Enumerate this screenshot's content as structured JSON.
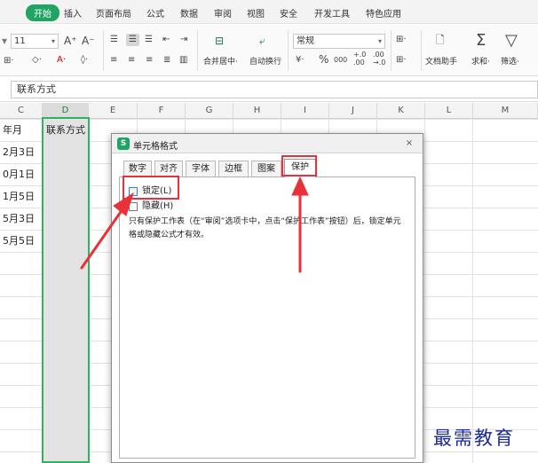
{
  "menu": {
    "items": [
      "开始",
      "插入",
      "页面布局",
      "公式",
      "数据",
      "审阅",
      "视图",
      "安全",
      "开发工具",
      "特色应用"
    ],
    "active_index": 0
  },
  "toolbar": {
    "font_size": "11",
    "font_size_arrow": "▾",
    "grow_font": "A⁺",
    "shrink_font": "A⁻",
    "merge_center": "合并居中·",
    "wrap_text": "自动换行",
    "number_format": "常规",
    "number_format_arrow": "▾",
    "currency": "¥·",
    "percent": "%",
    "thousands": "000",
    "inc_decimal": "+.0\n.00",
    "dec_decimal": ".00\n→.0",
    "doc_helper": "文档助手",
    "sum": "求和·",
    "filter": "筛选·",
    "sum_glyph": "Σ",
    "filter_glyph": "▽"
  },
  "formula_bar": {
    "value": "联系方式"
  },
  "grid": {
    "columns": [
      "C",
      "D",
      "E",
      "F",
      "G",
      "H",
      "I",
      "J",
      "K",
      "L",
      "M"
    ],
    "selected_column": "D",
    "header_cell": "联系方式",
    "col_c_partial": [
      "年月",
      "2月3日",
      "0月1日",
      "1月5日",
      "5月3日",
      "5月5日"
    ]
  },
  "dialog": {
    "title": "单元格格式",
    "close_glyph": "×",
    "tabs": [
      "数字",
      "对齐",
      "字体",
      "边框",
      "图案",
      "保护"
    ],
    "active_tab": "保护",
    "lock_label": "锁定(L)",
    "hide_label": "隐藏(H)",
    "description": "只有保护工作表（在“审阅”选项卡中，点击“保护工作表”按钮）后，锁定单元格或隐藏公式才有效。"
  },
  "annotation_color": "#e8313a",
  "accent_color": "#1fa463",
  "watermark": "最需教育"
}
